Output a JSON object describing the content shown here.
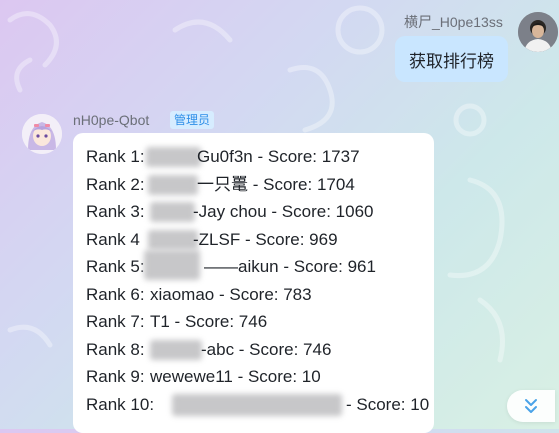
{
  "chat": {
    "self": {
      "username": "横尸_H0pe13ss",
      "message": "获取排行榜"
    },
    "bot": {
      "username": "nH0pe-Qbot",
      "role_badge": "管理员",
      "ranking": [
        {
          "prefix": "Rank 1:",
          "text": "Gu0f3n - Score: 1737"
        },
        {
          "prefix": "Rank 2:",
          "text": "一只鼍 - Score: 1704"
        },
        {
          "prefix": "Rank 3:",
          "text": "-Jay chou - Score: 1060"
        },
        {
          "prefix": "Rank 4",
          "text": "-ZLSF - Score: 969"
        },
        {
          "prefix": "Rank 5:",
          "text": "——aikun - Score: 961"
        },
        {
          "prefix": "Rank 6:",
          "text": "xiaomao - Score: 783"
        },
        {
          "prefix": "Rank 7:",
          "text": "T1 - Score: 746"
        },
        {
          "prefix": "Rank 8:",
          "text": "-abc - Score: 746"
        },
        {
          "prefix": "Rank 9:",
          "text": "wewewe11 - Score: 10"
        },
        {
          "prefix": "Rank 10:",
          "text": "- Score: 10"
        }
      ]
    }
  },
  "icons": {
    "scroll_down": "double-chevron-down-icon",
    "self_avatar": "user-avatar",
    "bot_avatar": "anime-girl-avatar"
  },
  "colors": {
    "self_bubble": "#c9e6ff",
    "bot_bubble": "#ffffff",
    "badge_bg": "#d6ecff",
    "badge_text": "#2e8fe8",
    "scroll_icon": "#4aa3e8"
  }
}
